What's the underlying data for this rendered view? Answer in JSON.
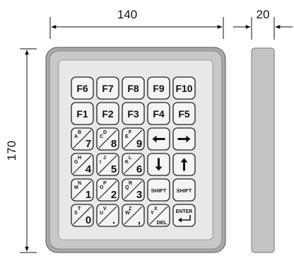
{
  "dimensions": {
    "width": "140",
    "depth": "20",
    "height": "170"
  },
  "fkeys_row1": [
    "F6",
    "F7",
    "F8",
    "F9",
    "F10"
  ],
  "fkeys_row2": [
    "F1",
    "F2",
    "F3",
    "F4",
    "F5"
  ],
  "numeric_keys": [
    {
      "main": "7",
      "a": "A",
      "b": "B"
    },
    {
      "main": "8",
      "a": "C",
      "b": "D"
    },
    {
      "main": "9",
      "a": "E",
      "b": "F"
    },
    {
      "main": "4",
      "a": "G",
      "b": "H"
    },
    {
      "main": "5",
      "a": "I",
      "b": "J"
    },
    {
      "main": "6",
      "a": "K",
      "b": "L"
    },
    {
      "main": "1",
      "a": "M",
      "b": "N"
    },
    {
      "main": "2",
      "a": "O",
      "b": "P"
    },
    {
      "main": "3",
      "a": "Q",
      "b": "R"
    },
    {
      "main": "0",
      "a": "S",
      "b": "T"
    },
    {
      "main": ".",
      "a": "U",
      "b": "V"
    },
    {
      "main": ",",
      "a": "W",
      "b": "Z"
    },
    {
      "main": "DEL",
      "a": "Y",
      "b": "X"
    }
  ],
  "shift_labels": [
    "SHIFT",
    "SHIFT"
  ],
  "enter_label": "ENTER",
  "arrow_keys": [
    "left-arrow",
    "right-arrow",
    "down-arrow",
    "up-arrow"
  ],
  "colors": {
    "bezel": "#b9b9b9",
    "panel": "#e8e8e8",
    "key": "#f2f2f2",
    "side": "#c4c4c4"
  }
}
